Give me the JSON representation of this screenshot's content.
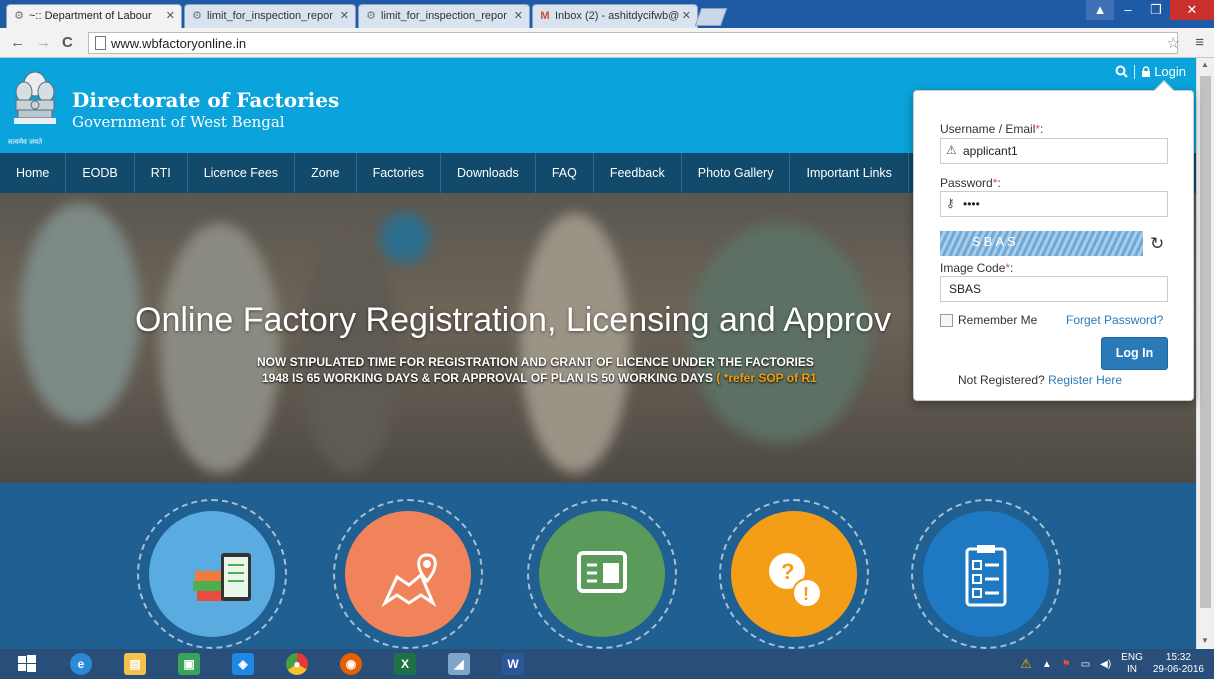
{
  "browser": {
    "tabs": [
      {
        "title": "~:: Department of Labour",
        "active": true
      },
      {
        "title": "limit_for_inspection_repor",
        "active": false
      },
      {
        "title": "limit_for_inspection_repor",
        "active": false
      },
      {
        "title": "Inbox (2) - ashitdycifwb@",
        "active": false
      }
    ],
    "url": "www.wbfactoryonline.in"
  },
  "site": {
    "title": "Directorate of Factories",
    "subtitle": "Government of West Bengal",
    "emblem_caption": "सत्यमेव जयते",
    "login_link": "Login"
  },
  "nav": {
    "items": [
      "Home",
      "EODB",
      "RTI",
      "Licence Fees",
      "Zone",
      "Factories",
      "Downloads",
      "FAQ",
      "Feedback",
      "Photo Gallery",
      "Important Links"
    ]
  },
  "hero": {
    "title": "Online Factory Registration, Licensing and Approv",
    "line1": "NOW STIPULATED TIME FOR REGISTRATION AND GRANT OF LICENCE UNDER THE FACTORIES",
    "line2": "1948 IS 65 WORKING DAYS & FOR APPROVAL OF PLAN IS 50 WORKING DAYS",
    "line2_highlight": "( *refer SOP of R1"
  },
  "login": {
    "username_label": "Username / Email",
    "username_value": "applicant1",
    "password_label": "Password",
    "password_value": "••••",
    "captcha_text": "SBAS",
    "image_code_label": "Image Code",
    "image_code_value": "SBAS",
    "remember_label": "Remember Me",
    "forget_label": "Forget Password?",
    "button_label": "Log In",
    "not_registered": "Not Registered?",
    "register_label": "Register Here"
  },
  "circles": [
    {
      "name": "books-circle",
      "color": "#5aace0"
    },
    {
      "name": "map-circle",
      "color": "#f0835a"
    },
    {
      "name": "id-card-circle",
      "color": "#5a9a5a"
    },
    {
      "name": "faq-circle",
      "color": "#f49d16"
    },
    {
      "name": "checklist-circle",
      "color": "#1e78c2"
    }
  ],
  "taskbar": {
    "lang_top": "ENG",
    "lang_bottom": "IN",
    "time": "15:32",
    "date": "29-06-2016"
  }
}
